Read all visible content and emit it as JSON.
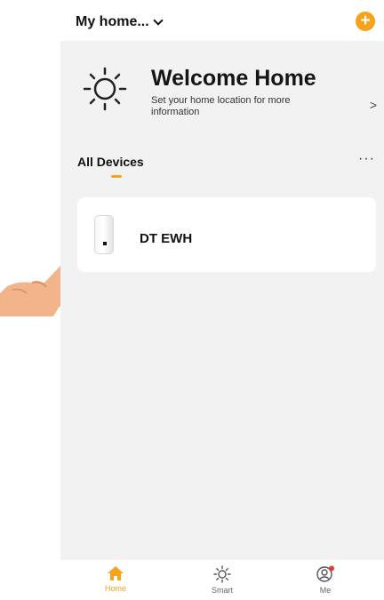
{
  "header": {
    "home_name": "My home...",
    "add_label": "+"
  },
  "welcome": {
    "title": "Welcome Home",
    "subtitle": "Set your home location for more information",
    "arrow": ">"
  },
  "tabs": {
    "all_devices": "All Devices",
    "more": "···"
  },
  "devices": [
    {
      "name": "DT EWH"
    }
  ],
  "bottom_nav": [
    {
      "label": "Home",
      "icon": "home-icon",
      "active": true
    },
    {
      "label": "Smart",
      "icon": "sun-icon",
      "active": false
    },
    {
      "label": "Me",
      "icon": "profile-icon",
      "active": false
    }
  ],
  "colors": {
    "accent": "#f6a21b",
    "background": "#f2f2f2",
    "card": "#ffffff",
    "notification_dot": "#e63a2e",
    "hand_skin": "#f2b48a"
  }
}
